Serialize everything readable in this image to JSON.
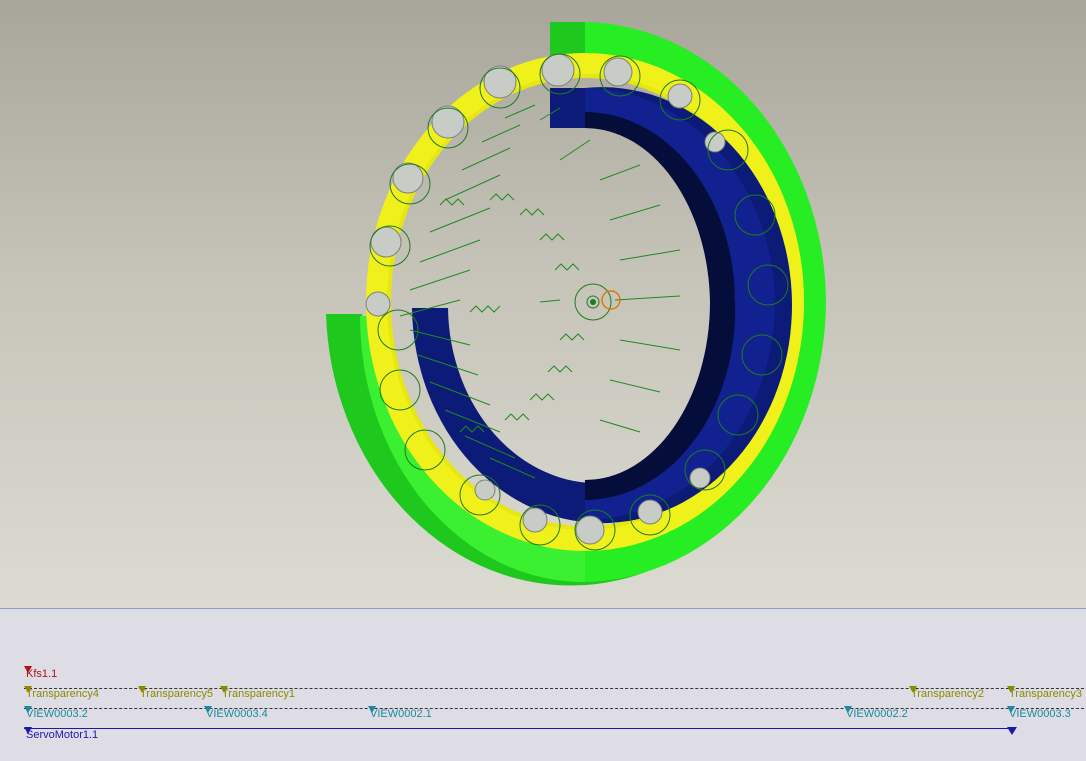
{
  "viewport": {
    "scene": "3D assembly view: ring gear with planetary gears",
    "colors": {
      "outer_ring": "#22e01e",
      "middle_ring": "#f2f21a",
      "inner_ring": "#0f1c7a",
      "gear_outline": "#1f7a1f",
      "pinion_gears": "#c8cec8",
      "center_marker": "#e07a00"
    }
  },
  "timeline": {
    "tracks": [
      {
        "type": "kfs",
        "markers": [
          {
            "label": "Kfs1.1"
          }
        ]
      },
      {
        "type": "transparency",
        "markers": [
          {
            "label": "Transparency4"
          },
          {
            "label": "Transparency5"
          },
          {
            "label": "Transparency1"
          },
          {
            "label": "Transparency2"
          },
          {
            "label": "Transparency3"
          }
        ]
      },
      {
        "type": "view",
        "markers": [
          {
            "label": "VIEW0003.2"
          },
          {
            "label": "VIEW0003.4"
          },
          {
            "label": "VIEW0002.1"
          },
          {
            "label": "VIEW0002.2"
          },
          {
            "label": "VIEW0003.3"
          }
        ]
      },
      {
        "type": "servo",
        "markers": [
          {
            "label": "ServoMotor1.1"
          }
        ]
      }
    ]
  }
}
